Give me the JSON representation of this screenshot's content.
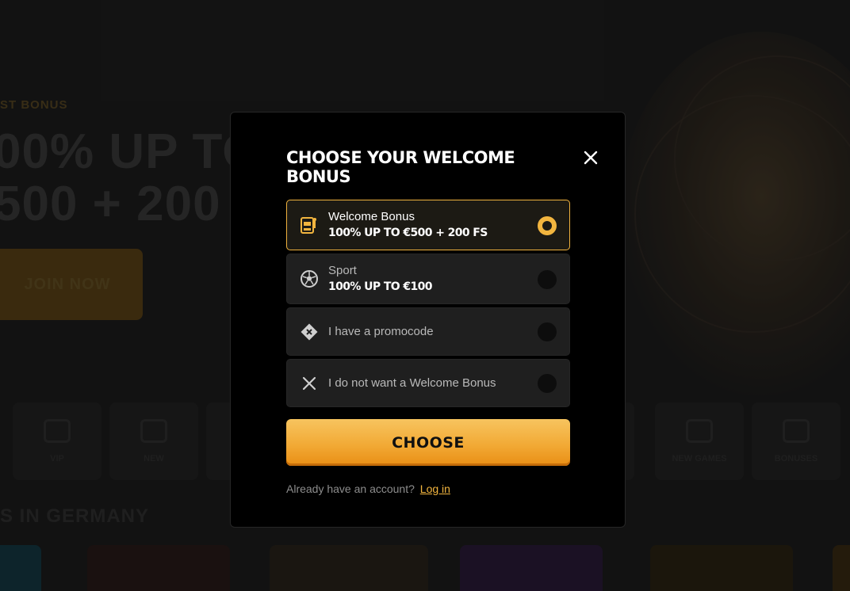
{
  "background": {
    "kicker": "ST BONUS",
    "headline_line1": "00% UP TO",
    "headline_line2": "500 + 200",
    "cta_label": "JOIN NOW",
    "tiles": [
      "VIP",
      "NEW",
      "",
      "",
      "",
      "",
      "",
      "NEW GAMES",
      "BONUSES"
    ],
    "section_title": "S IN GERMANY"
  },
  "modal": {
    "title": "CHOOSE YOUR WELCOME BONUS",
    "options": [
      {
        "name": "Welcome Bonus",
        "value": "100% UP TO €500 + 200 FS",
        "icon": "slot-machine-icon",
        "selected": true
      },
      {
        "name": "Sport",
        "value": "100% UP TO €100",
        "icon": "soccer-ball-icon",
        "selected": false
      },
      {
        "name": "I have a promocode",
        "icon": "ticket-icon",
        "selected": false
      },
      {
        "name": "I do not want a Welcome Bonus",
        "icon": "x-icon",
        "selected": false
      }
    ],
    "choose_label": "CHOOSE",
    "footer_text": "Already have an account?",
    "login_label": "Log in"
  },
  "colors": {
    "accent": "#f2b53f",
    "button_bottom": "#e98e14",
    "modal_bg": "#000000",
    "option_bg": "#1f1f1f"
  }
}
